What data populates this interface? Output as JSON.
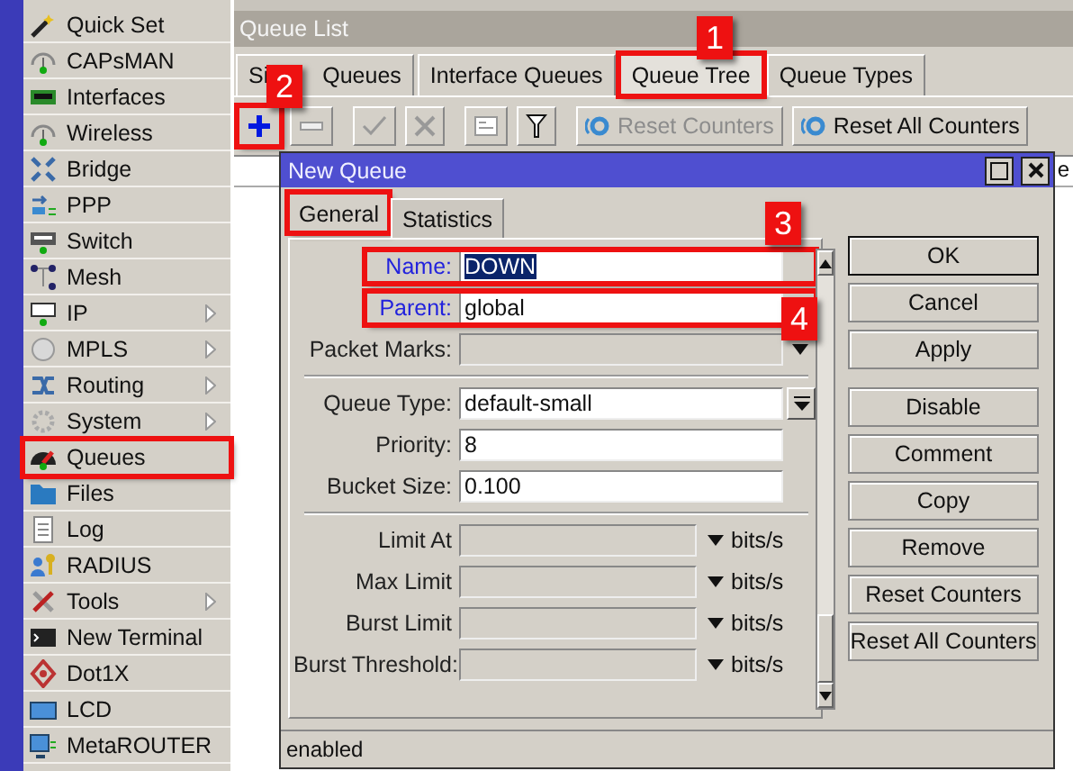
{
  "sidebar": {
    "items": [
      {
        "label": "Quick Set",
        "submenu": false,
        "highlighted": false
      },
      {
        "label": "CAPsMAN",
        "submenu": false,
        "highlighted": false
      },
      {
        "label": "Interfaces",
        "submenu": false,
        "highlighted": false
      },
      {
        "label": "Wireless",
        "submenu": false,
        "highlighted": false
      },
      {
        "label": "Bridge",
        "submenu": false,
        "highlighted": false
      },
      {
        "label": "PPP",
        "submenu": false,
        "highlighted": false
      },
      {
        "label": "Switch",
        "submenu": false,
        "highlighted": false
      },
      {
        "label": "Mesh",
        "submenu": false,
        "highlighted": false
      },
      {
        "label": "IP",
        "submenu": true,
        "highlighted": false
      },
      {
        "label": "MPLS",
        "submenu": true,
        "highlighted": false
      },
      {
        "label": "Routing",
        "submenu": true,
        "highlighted": false
      },
      {
        "label": "System",
        "submenu": true,
        "highlighted": false
      },
      {
        "label": "Queues",
        "submenu": false,
        "highlighted": true
      },
      {
        "label": "Files",
        "submenu": false,
        "highlighted": false
      },
      {
        "label": "Log",
        "submenu": false,
        "highlighted": false
      },
      {
        "label": "RADIUS",
        "submenu": false,
        "highlighted": false
      },
      {
        "label": "Tools",
        "submenu": true,
        "highlighted": false
      },
      {
        "label": "New Terminal",
        "submenu": false,
        "highlighted": false
      },
      {
        "label": "Dot1X",
        "submenu": false,
        "highlighted": false
      },
      {
        "label": "LCD",
        "submenu": false,
        "highlighted": false
      },
      {
        "label": "MetaROUTER",
        "submenu": false,
        "highlighted": false
      }
    ]
  },
  "window": {
    "title": "Queue List",
    "tabs": [
      {
        "label": "Si",
        "label_end": "Queues",
        "selected": false,
        "highlighted": false
      },
      {
        "label": "Interface Queues",
        "selected": false,
        "highlighted": false
      },
      {
        "label": "Queue Tree",
        "selected": true,
        "highlighted": true
      },
      {
        "label": "Queue Types",
        "selected": false,
        "highlighted": false
      }
    ],
    "toolbar": [
      {
        "kind": "add",
        "disabled": false,
        "highlighted": true
      },
      {
        "kind": "remove",
        "disabled": true,
        "highlighted": false
      },
      {
        "kind": "enable",
        "disabled": true,
        "highlighted": false
      },
      {
        "kind": "disable",
        "disabled": true,
        "highlighted": false
      },
      {
        "kind": "comment",
        "disabled": true,
        "highlighted": false
      },
      {
        "kind": "filter",
        "disabled": false,
        "highlighted": false
      },
      {
        "kind": "reset",
        "label": "Reset Counters",
        "disabled": true,
        "highlighted": false
      },
      {
        "kind": "reset",
        "label": "Reset All Counters",
        "disabled": false,
        "highlighted": false
      }
    ],
    "table": {
      "column_5": "e"
    }
  },
  "dialog": {
    "title": "New Queue",
    "tabs": [
      {
        "label": "General",
        "selected": true,
        "highlighted": true
      },
      {
        "label": "Statistics",
        "selected": false,
        "highlighted": false
      }
    ],
    "fields": [
      {
        "kind": "text",
        "label": "Name:",
        "value": "DOWN",
        "value_selected": true,
        "linked": true,
        "highlighted": true
      },
      {
        "kind": "text",
        "label": "Parent:",
        "value": "global",
        "value_selected": false,
        "linked": true,
        "highlighted": true
      },
      {
        "kind": "list",
        "label": "Packet Marks:",
        "linked": false,
        "highlighted": false
      },
      {
        "kind": "separator"
      },
      {
        "kind": "select",
        "label": "Queue Type:",
        "value": "default-small",
        "value_selected": false,
        "linked": false,
        "highlighted": false
      },
      {
        "kind": "text",
        "label": "Priority:",
        "value": "8",
        "value_selected": false,
        "linked": false,
        "highlighted": false
      },
      {
        "kind": "text",
        "label": "Bucket Size:",
        "value": "0.100",
        "value_selected": false,
        "linked": false,
        "highlighted": false
      },
      {
        "kind": "separator"
      },
      {
        "kind": "rate",
        "label": "Limit At",
        "unit": "bits/s",
        "linked": false,
        "highlighted": false
      },
      {
        "kind": "rate",
        "label": "Max Limit",
        "unit": "bits/s",
        "linked": false,
        "highlighted": false
      },
      {
        "kind": "rate",
        "label": "Burst Limit",
        "unit": "bits/s",
        "linked": false,
        "highlighted": false
      },
      {
        "kind": "rate",
        "label": "Burst Threshold:",
        "unit": "bits/s",
        "linked": false,
        "highlighted": false
      }
    ],
    "buttons": [
      {
        "label": "OK",
        "default": true
      },
      {
        "label": "Cancel",
        "default": false
      },
      {
        "label": "Apply",
        "default": false
      },
      {
        "label": "Disable",
        "default": false
      },
      {
        "label": "Comment",
        "default": false
      },
      {
        "label": "Copy",
        "default": false
      },
      {
        "label": "Remove",
        "default": false
      },
      {
        "label": "Reset Counters",
        "default": false
      },
      {
        "label": "Reset All Counters",
        "default": false
      }
    ],
    "status": "enabled"
  },
  "callouts": [
    "1",
    "2",
    "3",
    "4"
  ]
}
